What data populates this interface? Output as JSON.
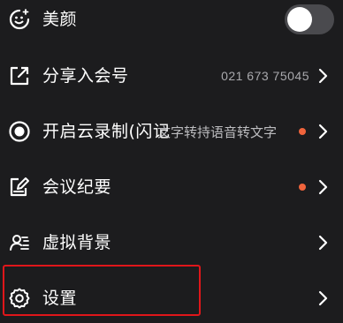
{
  "menu": {
    "items": [
      {
        "label": "美颜",
        "control": "toggle",
        "toggle_on": false,
        "icon": "beauty-smile-icon"
      },
      {
        "label": "分享入会号",
        "value": "021 673 75045",
        "icon": "share-export-icon"
      },
      {
        "label": "开启云录制(闪记",
        "overlay_text": "文字转持语音转文字",
        "icon": "record-icon",
        "badge_dot": true
      },
      {
        "label": "会议纪要",
        "icon": "notes-edit-icon",
        "badge_dot": true
      },
      {
        "label": "虚拟背景",
        "icon": "virtual-background-icon"
      },
      {
        "label": "设置",
        "icon": "settings-gear-icon",
        "highlighted": true
      }
    ]
  },
  "colors": {
    "background": "#1c1c1e",
    "text": "#ffffff",
    "secondary_text": "#a9a9ad",
    "badge_dot": "#f0643c",
    "highlight_border": "#e0161a",
    "toggle_track": "#4a4a4e"
  }
}
